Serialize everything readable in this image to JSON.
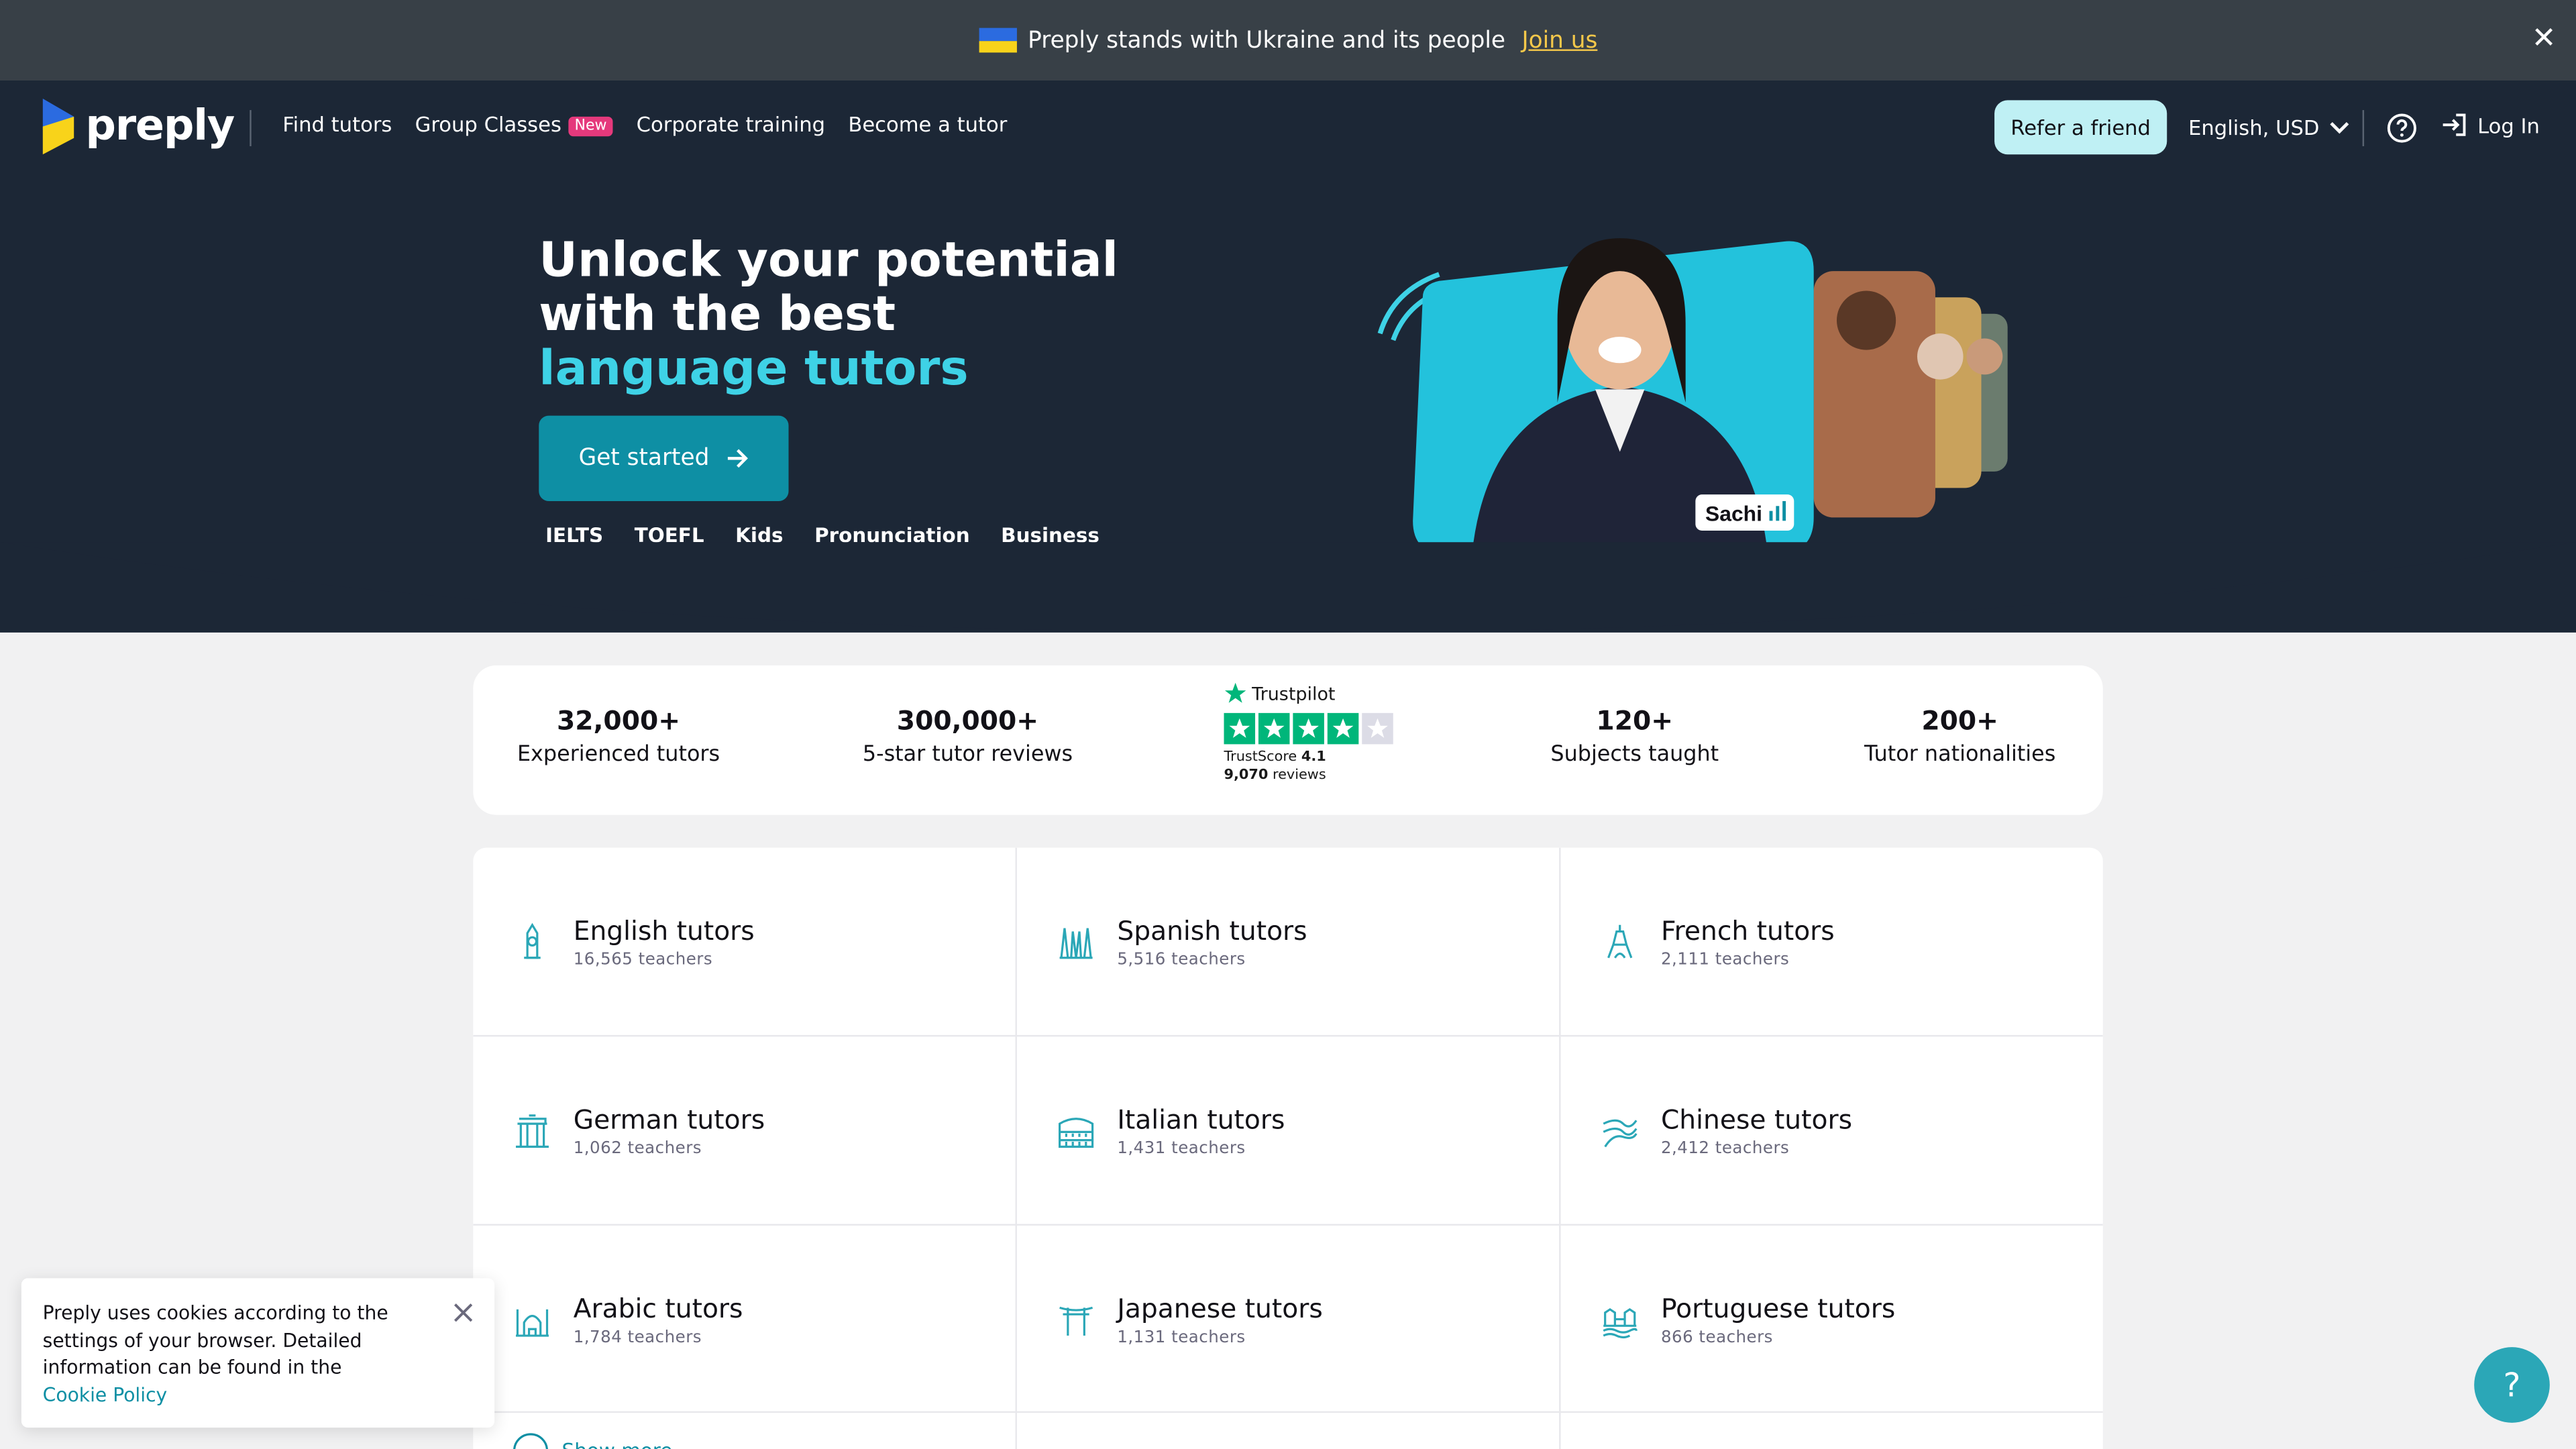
{
  "banner": {
    "text": "Preply stands with Ukraine and its people",
    "link": "Join us"
  },
  "nav": {
    "logo": "preply",
    "links": [
      "Find tutors",
      "Group Classes",
      "Corporate training",
      "Become a tutor"
    ],
    "new_badge": "New",
    "refer": "Refer a friend",
    "language": "English, USD",
    "login": "Log In"
  },
  "hero": {
    "line1": "Unlock your potential",
    "line2": "with the best",
    "accent": "language tutors",
    "cta": "Get started",
    "quick_links": [
      "IELTS",
      "TOEFL",
      "Kids",
      "Pronunciation",
      "Business"
    ],
    "tutor_name": "Sachi"
  },
  "stats": [
    {
      "num": "32,000+",
      "label": "Experienced tutors"
    },
    {
      "num": "300,000+",
      "label": "5-star tutor reviews"
    },
    {
      "num": "120+",
      "label": "Subjects taught"
    },
    {
      "num": "200+",
      "label": "Tutor nationalities"
    }
  ],
  "trustpilot": {
    "title": "Trustpilot",
    "score_label": "TrustScore",
    "score": "4.1",
    "reviews": "9,070",
    "reviews_label": "reviews",
    "rating_stars": 4
  },
  "languages": [
    {
      "name": "English tutors",
      "count": "16,565 teachers",
      "icon": "big-ben-icon"
    },
    {
      "name": "Spanish tutors",
      "count": "5,516 teachers",
      "icon": "sagrada-familia-icon"
    },
    {
      "name": "French tutors",
      "count": "2,111 teachers",
      "icon": "eiffel-tower-icon"
    },
    {
      "name": "German tutors",
      "count": "1,062 teachers",
      "icon": "brandenburg-gate-icon"
    },
    {
      "name": "Italian tutors",
      "count": "1,431 teachers",
      "icon": "colosseum-icon"
    },
    {
      "name": "Chinese tutors",
      "count": "2,412 teachers",
      "icon": "great-wall-icon"
    },
    {
      "name": "Arabic tutors",
      "count": "1,784 teachers",
      "icon": "mosque-icon"
    },
    {
      "name": "Japanese tutors",
      "count": "1,131 teachers",
      "icon": "torii-gate-icon"
    },
    {
      "name": "Portuguese tutors",
      "count": "866 teachers",
      "icon": "belem-tower-icon"
    }
  ],
  "show_more": "Show more",
  "cookie": {
    "text": "Preply uses cookies according to the settings of your browser. Detailed information can be found in the",
    "link": "Cookie Policy"
  },
  "help_fab": "?",
  "colors": {
    "hero_bg": "#1c2736",
    "accent": "#3ed2e6",
    "cta": "#0e8fa4",
    "banner_bg": "#384047"
  }
}
